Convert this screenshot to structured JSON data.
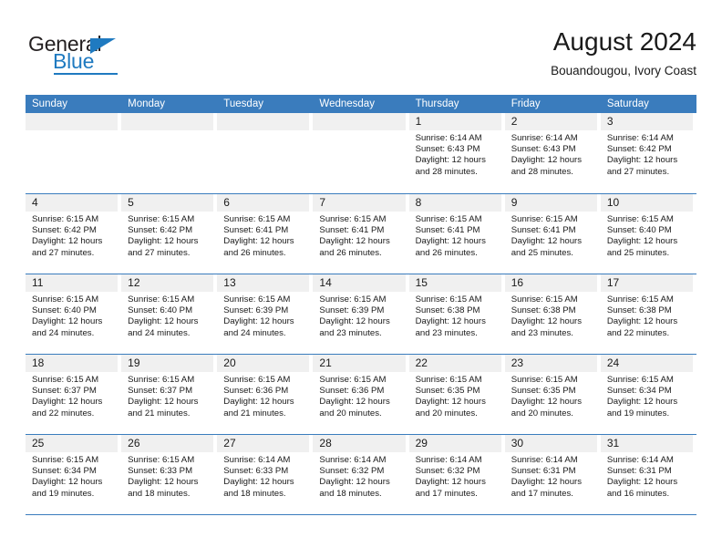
{
  "brand": {
    "name_part1": "General",
    "name_part2": "Blue",
    "logo_icon": "triangle-flag-icon"
  },
  "header": {
    "title": "August 2024",
    "subtitle": "Bouandougou, Ivory Coast"
  },
  "colors": {
    "header_blue": "#3a7cbd",
    "brand_blue": "#1f7ac0",
    "daynum_band": "#f0f0f0",
    "text": "#1a1a1a"
  },
  "weekdays": [
    "Sunday",
    "Monday",
    "Tuesday",
    "Wednesday",
    "Thursday",
    "Friday",
    "Saturday"
  ],
  "weeks": [
    [
      {
        "day": "",
        "sunrise": "",
        "sunset": "",
        "daylight1": "",
        "daylight2": ""
      },
      {
        "day": "",
        "sunrise": "",
        "sunset": "",
        "daylight1": "",
        "daylight2": ""
      },
      {
        "day": "",
        "sunrise": "",
        "sunset": "",
        "daylight1": "",
        "daylight2": ""
      },
      {
        "day": "",
        "sunrise": "",
        "sunset": "",
        "daylight1": "",
        "daylight2": ""
      },
      {
        "day": "1",
        "sunrise": "Sunrise: 6:14 AM",
        "sunset": "Sunset: 6:43 PM",
        "daylight1": "Daylight: 12 hours",
        "daylight2": "and 28 minutes."
      },
      {
        "day": "2",
        "sunrise": "Sunrise: 6:14 AM",
        "sunset": "Sunset: 6:43 PM",
        "daylight1": "Daylight: 12 hours",
        "daylight2": "and 28 minutes."
      },
      {
        "day": "3",
        "sunrise": "Sunrise: 6:14 AM",
        "sunset": "Sunset: 6:42 PM",
        "daylight1": "Daylight: 12 hours",
        "daylight2": "and 27 minutes."
      }
    ],
    [
      {
        "day": "4",
        "sunrise": "Sunrise: 6:15 AM",
        "sunset": "Sunset: 6:42 PM",
        "daylight1": "Daylight: 12 hours",
        "daylight2": "and 27 minutes."
      },
      {
        "day": "5",
        "sunrise": "Sunrise: 6:15 AM",
        "sunset": "Sunset: 6:42 PM",
        "daylight1": "Daylight: 12 hours",
        "daylight2": "and 27 minutes."
      },
      {
        "day": "6",
        "sunrise": "Sunrise: 6:15 AM",
        "sunset": "Sunset: 6:41 PM",
        "daylight1": "Daylight: 12 hours",
        "daylight2": "and 26 minutes."
      },
      {
        "day": "7",
        "sunrise": "Sunrise: 6:15 AM",
        "sunset": "Sunset: 6:41 PM",
        "daylight1": "Daylight: 12 hours",
        "daylight2": "and 26 minutes."
      },
      {
        "day": "8",
        "sunrise": "Sunrise: 6:15 AM",
        "sunset": "Sunset: 6:41 PM",
        "daylight1": "Daylight: 12 hours",
        "daylight2": "and 26 minutes."
      },
      {
        "day": "9",
        "sunrise": "Sunrise: 6:15 AM",
        "sunset": "Sunset: 6:41 PM",
        "daylight1": "Daylight: 12 hours",
        "daylight2": "and 25 minutes."
      },
      {
        "day": "10",
        "sunrise": "Sunrise: 6:15 AM",
        "sunset": "Sunset: 6:40 PM",
        "daylight1": "Daylight: 12 hours",
        "daylight2": "and 25 minutes."
      }
    ],
    [
      {
        "day": "11",
        "sunrise": "Sunrise: 6:15 AM",
        "sunset": "Sunset: 6:40 PM",
        "daylight1": "Daylight: 12 hours",
        "daylight2": "and 24 minutes."
      },
      {
        "day": "12",
        "sunrise": "Sunrise: 6:15 AM",
        "sunset": "Sunset: 6:40 PM",
        "daylight1": "Daylight: 12 hours",
        "daylight2": "and 24 minutes."
      },
      {
        "day": "13",
        "sunrise": "Sunrise: 6:15 AM",
        "sunset": "Sunset: 6:39 PM",
        "daylight1": "Daylight: 12 hours",
        "daylight2": "and 24 minutes."
      },
      {
        "day": "14",
        "sunrise": "Sunrise: 6:15 AM",
        "sunset": "Sunset: 6:39 PM",
        "daylight1": "Daylight: 12 hours",
        "daylight2": "and 23 minutes."
      },
      {
        "day": "15",
        "sunrise": "Sunrise: 6:15 AM",
        "sunset": "Sunset: 6:38 PM",
        "daylight1": "Daylight: 12 hours",
        "daylight2": "and 23 minutes."
      },
      {
        "day": "16",
        "sunrise": "Sunrise: 6:15 AM",
        "sunset": "Sunset: 6:38 PM",
        "daylight1": "Daylight: 12 hours",
        "daylight2": "and 23 minutes."
      },
      {
        "day": "17",
        "sunrise": "Sunrise: 6:15 AM",
        "sunset": "Sunset: 6:38 PM",
        "daylight1": "Daylight: 12 hours",
        "daylight2": "and 22 minutes."
      }
    ],
    [
      {
        "day": "18",
        "sunrise": "Sunrise: 6:15 AM",
        "sunset": "Sunset: 6:37 PM",
        "daylight1": "Daylight: 12 hours",
        "daylight2": "and 22 minutes."
      },
      {
        "day": "19",
        "sunrise": "Sunrise: 6:15 AM",
        "sunset": "Sunset: 6:37 PM",
        "daylight1": "Daylight: 12 hours",
        "daylight2": "and 21 minutes."
      },
      {
        "day": "20",
        "sunrise": "Sunrise: 6:15 AM",
        "sunset": "Sunset: 6:36 PM",
        "daylight1": "Daylight: 12 hours",
        "daylight2": "and 21 minutes."
      },
      {
        "day": "21",
        "sunrise": "Sunrise: 6:15 AM",
        "sunset": "Sunset: 6:36 PM",
        "daylight1": "Daylight: 12 hours",
        "daylight2": "and 20 minutes."
      },
      {
        "day": "22",
        "sunrise": "Sunrise: 6:15 AM",
        "sunset": "Sunset: 6:35 PM",
        "daylight1": "Daylight: 12 hours",
        "daylight2": "and 20 minutes."
      },
      {
        "day": "23",
        "sunrise": "Sunrise: 6:15 AM",
        "sunset": "Sunset: 6:35 PM",
        "daylight1": "Daylight: 12 hours",
        "daylight2": "and 20 minutes."
      },
      {
        "day": "24",
        "sunrise": "Sunrise: 6:15 AM",
        "sunset": "Sunset: 6:34 PM",
        "daylight1": "Daylight: 12 hours",
        "daylight2": "and 19 minutes."
      }
    ],
    [
      {
        "day": "25",
        "sunrise": "Sunrise: 6:15 AM",
        "sunset": "Sunset: 6:34 PM",
        "daylight1": "Daylight: 12 hours",
        "daylight2": "and 19 minutes."
      },
      {
        "day": "26",
        "sunrise": "Sunrise: 6:15 AM",
        "sunset": "Sunset: 6:33 PM",
        "daylight1": "Daylight: 12 hours",
        "daylight2": "and 18 minutes."
      },
      {
        "day": "27",
        "sunrise": "Sunrise: 6:14 AM",
        "sunset": "Sunset: 6:33 PM",
        "daylight1": "Daylight: 12 hours",
        "daylight2": "and 18 minutes."
      },
      {
        "day": "28",
        "sunrise": "Sunrise: 6:14 AM",
        "sunset": "Sunset: 6:32 PM",
        "daylight1": "Daylight: 12 hours",
        "daylight2": "and 18 minutes."
      },
      {
        "day": "29",
        "sunrise": "Sunrise: 6:14 AM",
        "sunset": "Sunset: 6:32 PM",
        "daylight1": "Daylight: 12 hours",
        "daylight2": "and 17 minutes."
      },
      {
        "day": "30",
        "sunrise": "Sunrise: 6:14 AM",
        "sunset": "Sunset: 6:31 PM",
        "daylight1": "Daylight: 12 hours",
        "daylight2": "and 17 minutes."
      },
      {
        "day": "31",
        "sunrise": "Sunrise: 6:14 AM",
        "sunset": "Sunset: 6:31 PM",
        "daylight1": "Daylight: 12 hours",
        "daylight2": "and 16 minutes."
      }
    ]
  ]
}
